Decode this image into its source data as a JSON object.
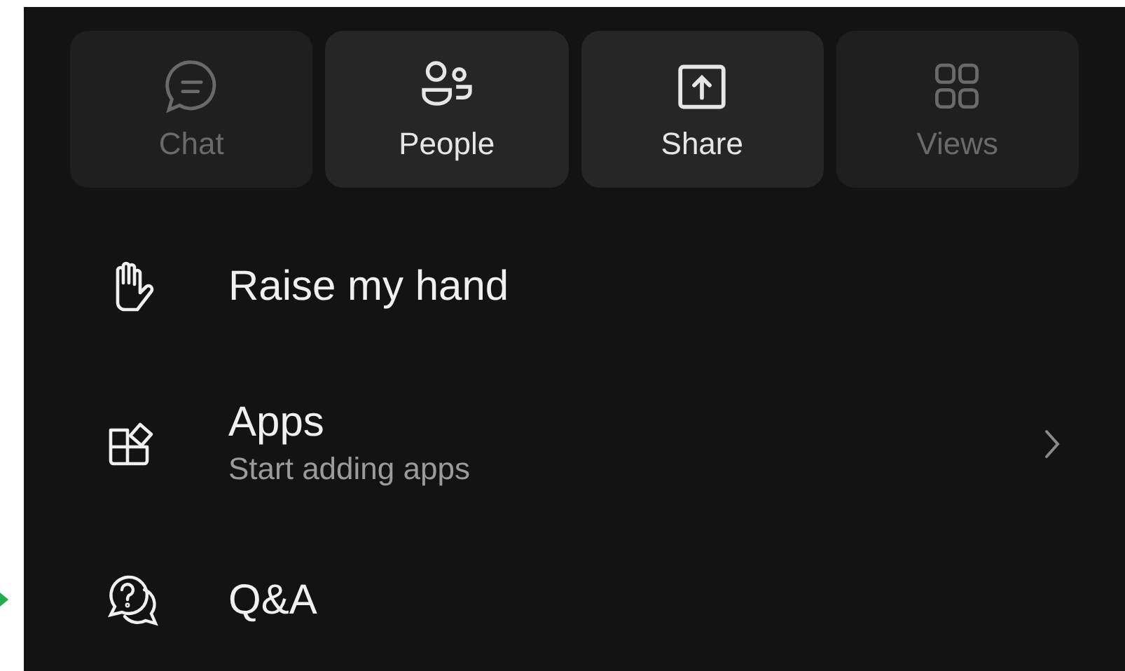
{
  "actions": [
    {
      "label": "Chat",
      "kind": "chat",
      "disabled": true
    },
    {
      "label": "People",
      "kind": "people",
      "disabled": false
    },
    {
      "label": "Share",
      "kind": "share",
      "disabled": false
    },
    {
      "label": "Views",
      "kind": "views",
      "disabled": true
    }
  ],
  "menu": [
    {
      "title": "Raise my hand",
      "kind": "hand"
    },
    {
      "title": "Apps",
      "subtitle": "Start adding apps",
      "kind": "apps",
      "chevron": true
    },
    {
      "title": "Q&A",
      "kind": "qa"
    }
  ]
}
